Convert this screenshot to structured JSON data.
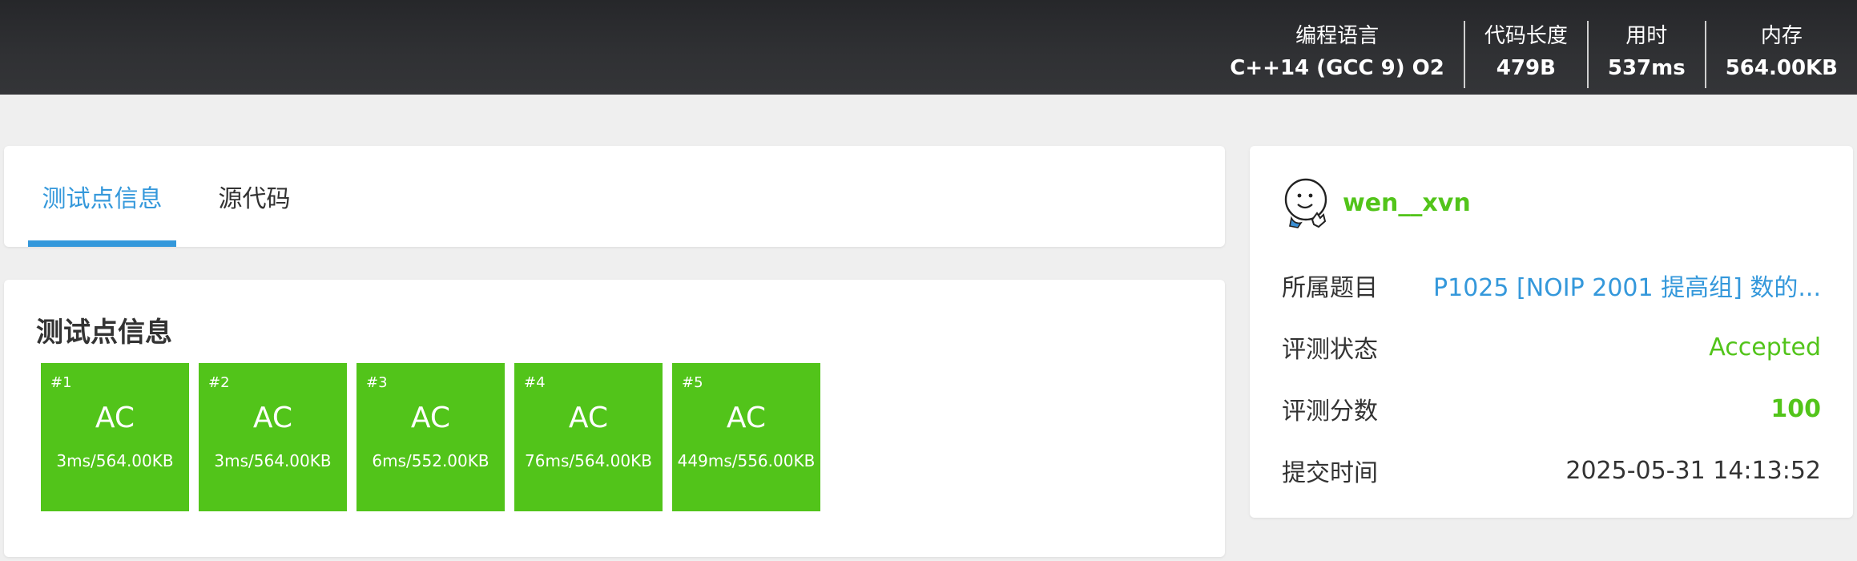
{
  "header": {
    "stats": [
      {
        "label": "编程语言",
        "value": "C++14 (GCC 9) O2"
      },
      {
        "label": "代码长度",
        "value": "479B"
      },
      {
        "label": "用时",
        "value": "537ms"
      },
      {
        "label": "内存",
        "value": "564.00KB"
      }
    ]
  },
  "tabs": [
    {
      "label": "测试点信息",
      "active": true
    },
    {
      "label": "源代码",
      "active": false
    }
  ],
  "testpoints": {
    "title": "测试点信息",
    "cases": [
      {
        "index": "#1",
        "status": "AC",
        "meta": "3ms/564.00KB"
      },
      {
        "index": "#2",
        "status": "AC",
        "meta": "3ms/564.00KB"
      },
      {
        "index": "#3",
        "status": "AC",
        "meta": "6ms/552.00KB"
      },
      {
        "index": "#4",
        "status": "AC",
        "meta": "76ms/564.00KB"
      },
      {
        "index": "#5",
        "status": "AC",
        "meta": "449ms/556.00KB"
      }
    ],
    "ac_color": "#52c41a"
  },
  "info": {
    "username": "wen__xvn",
    "problem_label": "所属题目",
    "problem_value": "P1025 [NOIP 2001 提高组] 数的...",
    "status_label": "评测状态",
    "status_value": "Accepted",
    "score_label": "评测分数",
    "score_value": "100",
    "time_label": "提交时间",
    "time_value": "2025-05-31 14:13:52"
  },
  "colors": {
    "accent": "#3498db",
    "success": "#52c41a",
    "header_bg": "#2e2f32",
    "page_bg": "#efefef"
  }
}
